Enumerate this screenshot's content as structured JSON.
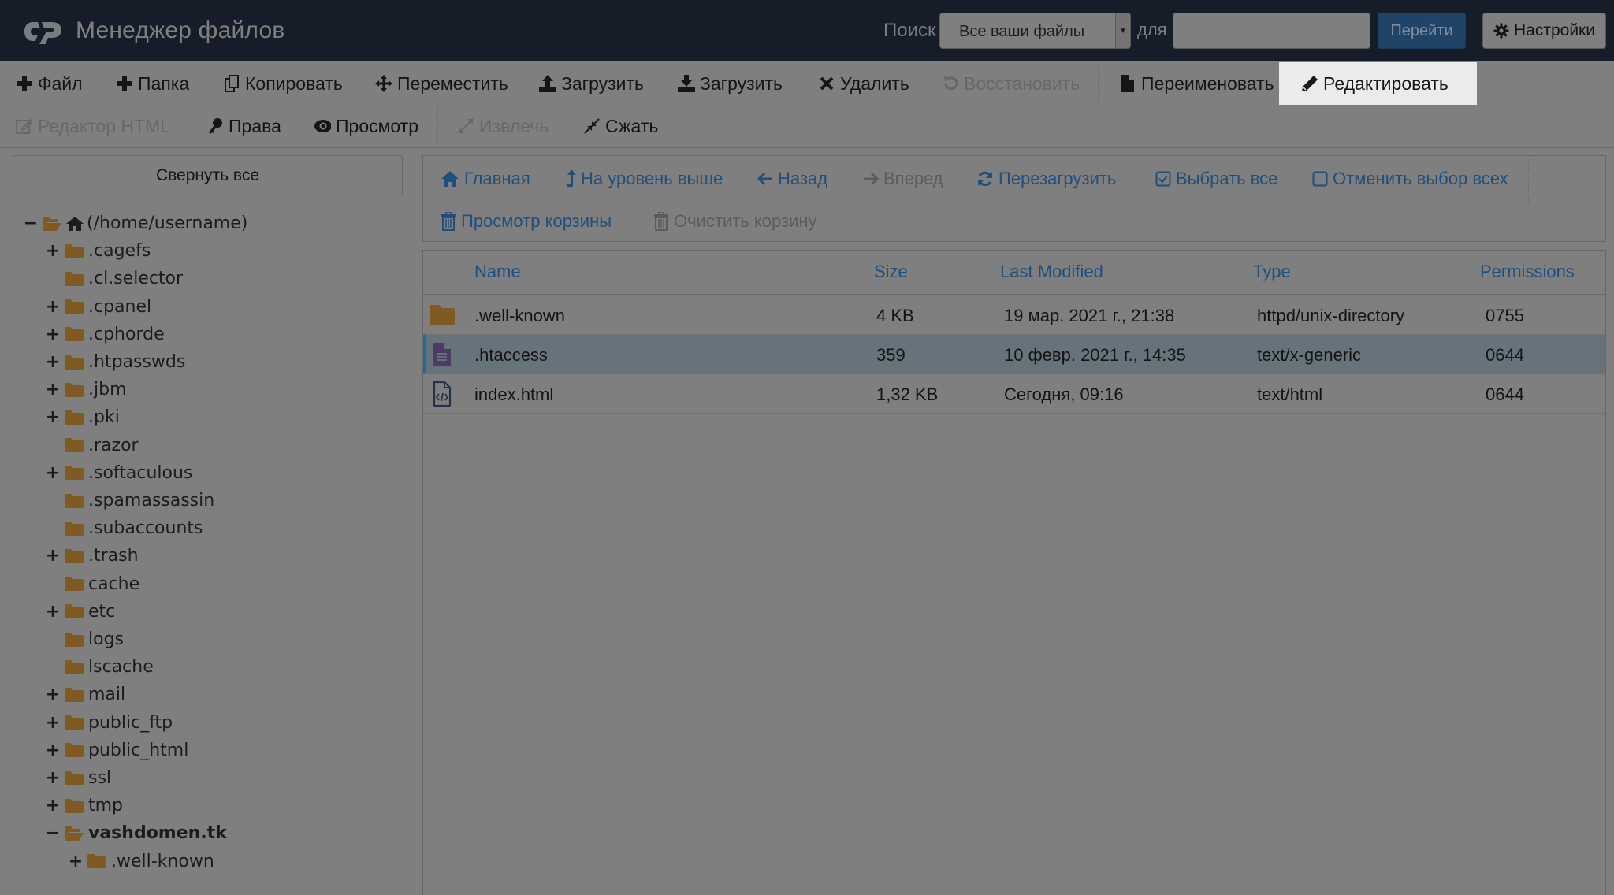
{
  "header": {
    "logo": "cpanel-logo",
    "title": "Менеджер файлов",
    "search_label": "Поиск",
    "search_scope": "Все ваши файлы",
    "for_label": "для",
    "search_value": "",
    "go_label": "Перейти",
    "settings_label": "Настройки"
  },
  "toolbar": {
    "row1": [
      {
        "id": "new-file",
        "icon": "plus-icon",
        "label": "Файл",
        "disabled": false
      },
      {
        "id": "new-folder",
        "icon": "plus-icon",
        "label": "Папка",
        "disabled": false
      },
      {
        "id": "copy",
        "icon": "copy-icon",
        "label": "Копировать",
        "disabled": false
      },
      {
        "id": "move",
        "icon": "move-icon",
        "label": "Переместить",
        "disabled": false
      },
      {
        "id": "upload",
        "icon": "upload-icon",
        "label": "Загрузить",
        "disabled": false
      },
      {
        "id": "download",
        "icon": "download-icon",
        "label": "Загрузить",
        "disabled": false
      },
      {
        "id": "delete",
        "icon": "close-icon",
        "label": "Удалить",
        "disabled": false
      },
      {
        "id": "restore",
        "icon": "undo-icon",
        "label": "Восстановить",
        "disabled": true
      },
      {
        "id": "rename",
        "icon": "file-icon",
        "label": "Переименовать",
        "disabled": false
      },
      {
        "id": "edit",
        "icon": "pencil-icon",
        "label": "Редактировать",
        "disabled": false,
        "active": true
      }
    ],
    "row2": [
      {
        "id": "html-editor",
        "icon": "edit-icon",
        "label": "Редактор HTML",
        "disabled": true
      },
      {
        "id": "permissions",
        "icon": "key-icon",
        "label": "Права",
        "disabled": false
      },
      {
        "id": "view",
        "icon": "eye-icon",
        "label": "Просмотр",
        "disabled": false
      },
      {
        "id": "extract",
        "icon": "expand-icon",
        "label": "Извлечь",
        "disabled": true
      },
      {
        "id": "compress",
        "icon": "compress-icon",
        "label": "Сжать",
        "disabled": false
      }
    ]
  },
  "sidebar": {
    "collapse_label": "Свернуть все",
    "tree": [
      {
        "label": "(/home/username)",
        "toggle": "−",
        "open": true,
        "home": true,
        "level": 0
      },
      {
        "label": ".cagefs",
        "toggle": "+",
        "level": 1
      },
      {
        "label": ".cl.selector",
        "toggle": "",
        "level": 1
      },
      {
        "label": ".cpanel",
        "toggle": "+",
        "level": 1
      },
      {
        "label": ".cphorde",
        "toggle": "+",
        "level": 1
      },
      {
        "label": ".htpasswds",
        "toggle": "+",
        "level": 1
      },
      {
        "label": ".jbm",
        "toggle": "+",
        "level": 1
      },
      {
        "label": ".pki",
        "toggle": "+",
        "level": 1
      },
      {
        "label": ".razor",
        "toggle": "",
        "level": 1
      },
      {
        "label": ".softaculous",
        "toggle": "+",
        "level": 1
      },
      {
        "label": ".spamassassin",
        "toggle": "",
        "level": 1
      },
      {
        "label": ".subaccounts",
        "toggle": "",
        "level": 1
      },
      {
        "label": ".trash",
        "toggle": "+",
        "level": 1
      },
      {
        "label": "cache",
        "toggle": "",
        "level": 1
      },
      {
        "label": "etc",
        "toggle": "+",
        "level": 1
      },
      {
        "label": "logs",
        "toggle": "",
        "level": 1
      },
      {
        "label": "lscache",
        "toggle": "",
        "level": 1
      },
      {
        "label": "mail",
        "toggle": "+",
        "level": 1
      },
      {
        "label": "public_ftp",
        "toggle": "+",
        "level": 1
      },
      {
        "label": "public_html",
        "toggle": "+",
        "level": 1
      },
      {
        "label": "ssl",
        "toggle": "+",
        "level": 1
      },
      {
        "label": "tmp",
        "toggle": "+",
        "level": 1
      },
      {
        "label": "vashdomen.tk",
        "toggle": "−",
        "open": true,
        "bold": true,
        "level": 1
      },
      {
        "label": ".well-known",
        "toggle": "+",
        "level": 2
      }
    ]
  },
  "nav": {
    "row1": [
      {
        "id": "home",
        "icon": "home-icon",
        "label": "Главная",
        "disabled": false
      },
      {
        "id": "up",
        "icon": "level-up-icon",
        "label": "На уровень выше",
        "disabled": false
      },
      {
        "id": "back",
        "icon": "arrow-left-icon",
        "label": "Назад",
        "disabled": false
      },
      {
        "id": "forward",
        "icon": "arrow-right-icon",
        "label": "Вперед",
        "disabled": true
      },
      {
        "id": "reload",
        "icon": "refresh-icon",
        "label": "Перезагрузить",
        "disabled": false
      },
      {
        "id": "select-all",
        "icon": "checkbox-checked-icon",
        "label": "Выбрать все",
        "disabled": false
      },
      {
        "id": "unselect-all",
        "icon": "checkbox-empty-icon",
        "label": "Отменить выбор всех",
        "disabled": false
      }
    ],
    "row2": [
      {
        "id": "view-trash",
        "icon": "trash-icon",
        "label": "Просмотр корзины",
        "disabled": false
      },
      {
        "id": "empty-trash",
        "icon": "trash-icon",
        "label": "Очистить корзину",
        "disabled": true
      }
    ]
  },
  "table": {
    "columns": [
      "Name",
      "Size",
      "Last Modified",
      "Type",
      "Permissions"
    ],
    "rows": [
      {
        "icon": "folder-icon",
        "name": ".well-known",
        "size": "4 KB",
        "modified": "19 мар. 2021 г., 21:38",
        "type": "httpd/unix-directory",
        "perms": "0755",
        "selected": false
      },
      {
        "icon": "text-file-icon",
        "name": ".htaccess",
        "size": "359",
        "modified": "10 февр. 2021 г., 14:35",
        "type": "text/x-generic",
        "perms": "0644",
        "selected": true
      },
      {
        "icon": "code-file-icon",
        "name": "index.html",
        "size": "1,32 KB",
        "modified": "Сегодня, 09:16",
        "type": "text/html",
        "perms": "0644",
        "selected": false
      }
    ]
  },
  "colors": {
    "header_bg": "#161d28",
    "page_bg": "#7f7f7f",
    "link": "#1e4f7d",
    "folder": "#7f5a22",
    "selected_row": "#67737b",
    "selected_accent": "#1e6d96",
    "go_button": "#1f4468"
  }
}
